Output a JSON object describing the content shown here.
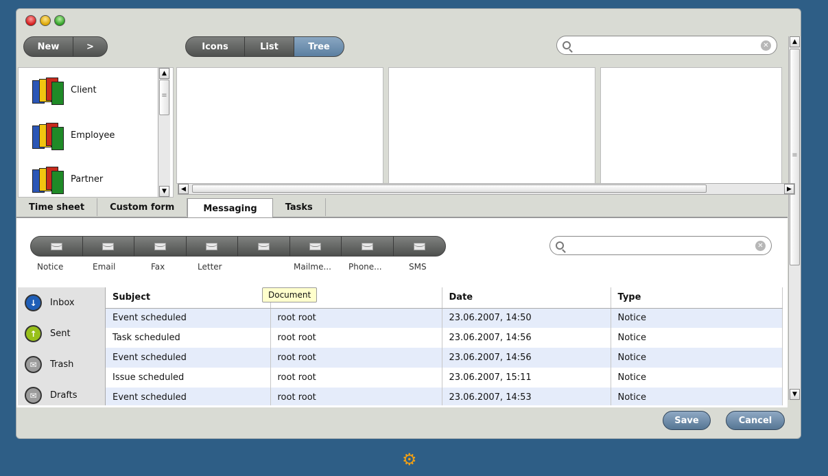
{
  "toolbar": {
    "new_label": "New",
    "next_label": ">",
    "views": [
      "Icons",
      "List",
      "Tree"
    ],
    "active_view": "Tree"
  },
  "search_top": {
    "value": "",
    "placeholder": ""
  },
  "tree": {
    "items": [
      "Client",
      "Employee",
      "Partner"
    ]
  },
  "tabs": {
    "items": [
      "Time sheet",
      "Custom form",
      "Messaging",
      "Tasks"
    ],
    "active": "Messaging"
  },
  "message_types": [
    "Notice",
    "Email",
    "Fax",
    "Letter",
    "",
    "Mailme...",
    "Phone...",
    "SMS"
  ],
  "search_msg": {
    "value": "",
    "placeholder": ""
  },
  "mail_folders": [
    "Inbox",
    "Sent",
    "Trash",
    "Drafts"
  ],
  "table": {
    "headers": [
      "Subject",
      "",
      "Date",
      "Type"
    ],
    "rows": [
      [
        "Event scheduled",
        "root root",
        "23.06.2007, 14:50",
        "Notice"
      ],
      [
        "Task scheduled",
        "root root",
        "23.06.2007, 14:56",
        "Notice"
      ],
      [
        "Event scheduled",
        "root root",
        "23.06.2007, 14:56",
        "Notice"
      ],
      [
        "Issue scheduled",
        "root root",
        "23.06.2007, 15:11",
        "Notice"
      ],
      [
        "Event scheduled",
        "root root",
        "23.06.2007, 14:53",
        "Notice"
      ]
    ]
  },
  "tooltip": "Document",
  "buttons": {
    "save": "Save",
    "cancel": "Cancel"
  },
  "colors": {
    "background": "#2e5e86",
    "accent": "#5b7fa1",
    "row_alt": "#e5ecfa",
    "tooltip": "#ffffcc"
  }
}
